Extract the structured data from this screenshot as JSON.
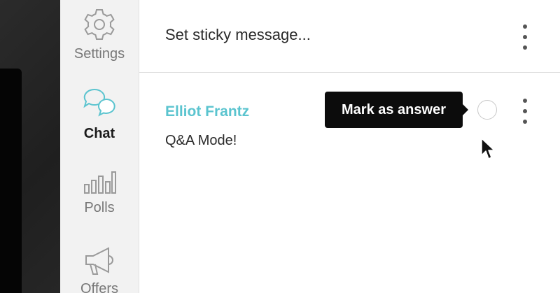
{
  "sidebar": {
    "items": [
      {
        "label": "Settings",
        "icon": "gear-icon",
        "active": false
      },
      {
        "label": "Chat",
        "icon": "chat-bubbles-icon",
        "active": true
      },
      {
        "label": "Polls",
        "icon": "bar-chart-icon",
        "active": false
      },
      {
        "label": "Offers",
        "icon": "megaphone-icon",
        "active": false
      }
    ]
  },
  "main": {
    "sticky_placeholder": "Set sticky message...",
    "message": {
      "author": "Elliot Frantz",
      "text": "Q&A Mode!",
      "tooltip": "Mark as answer"
    }
  },
  "colors": {
    "accent": "#5bc4cf",
    "tooltip_bg": "#0c0c0c",
    "sidebar_bg": "#f2f2f2"
  }
}
